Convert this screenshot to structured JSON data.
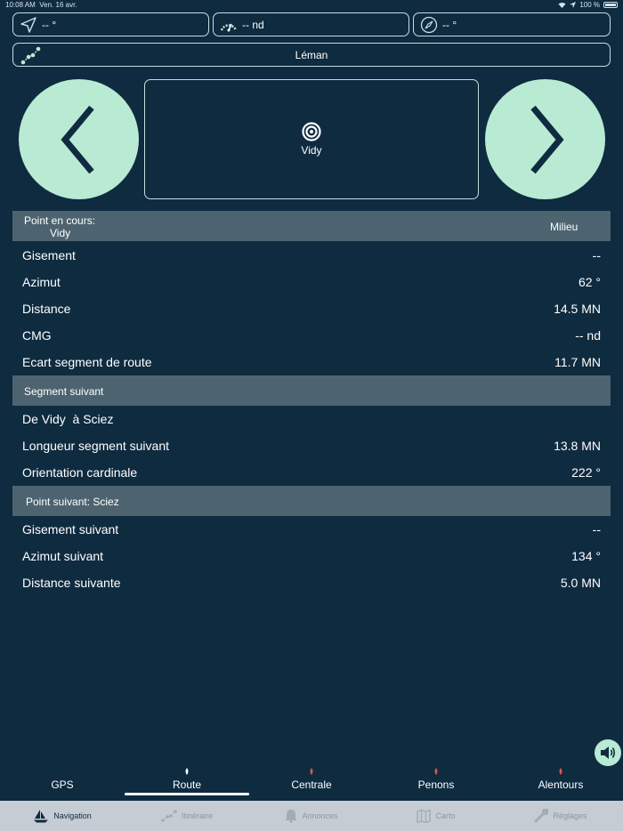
{
  "status_bar": {
    "time": "10:08 AM",
    "date": "Ven. 16 avr.",
    "battery": "100 %"
  },
  "info_boxes": [
    {
      "icon": "location-arrow-icon",
      "value": "-- °"
    },
    {
      "icon": "speedometer-icon",
      "value": "-- nd"
    },
    {
      "icon": "compass-icon",
      "value": "-- °"
    }
  ],
  "lake": {
    "icon": "route-dots-icon",
    "label": "Léman"
  },
  "target": {
    "icon": "target-icon",
    "label": "Vidy"
  },
  "current_point": {
    "header_label": "Point en cours:",
    "header_name": "Vidy",
    "header_right": "Milieu"
  },
  "current_rows": [
    {
      "label": "Gisement",
      "value": "--"
    },
    {
      "label": "Azimut",
      "value": "62 °"
    },
    {
      "label": "Distance",
      "value": "14.5 MN"
    },
    {
      "label": "CMG",
      "value": "-- nd"
    },
    {
      "label": "Ecart segment de route",
      "value": "11.7 MN"
    }
  ],
  "segment": {
    "header": "Segment suivant"
  },
  "segment_rows": [
    {
      "label": "De Vidy  à Sciez",
      "value": ""
    },
    {
      "label": "Longueur segment suivant",
      "value": "13.8 MN"
    },
    {
      "label": "Orientation cardinale",
      "value": "222 °"
    }
  ],
  "next_point": {
    "header": "Point suivant: Sciez"
  },
  "next_rows": [
    {
      "label": "Gisement suivant",
      "value": "--"
    },
    {
      "label": "Azimut suivant",
      "value": "134 °"
    },
    {
      "label": "Distance suivante",
      "value": "5.0 MN"
    }
  ],
  "sub_tabs": [
    {
      "label": "GPS",
      "indicator": "none"
    },
    {
      "label": "Route",
      "indicator": "white"
    },
    {
      "label": "Centrale",
      "indicator": "red"
    },
    {
      "label": "Penons",
      "indicator": "red"
    },
    {
      "label": "Alentours",
      "indicator": "red"
    }
  ],
  "tab_bar": [
    {
      "label": "Navigation",
      "icon": "sailboat-icon",
      "active": true
    },
    {
      "label": "Itinéraire",
      "icon": "route-icon",
      "active": false
    },
    {
      "label": "Annonces",
      "icon": "bell-icon",
      "active": false
    },
    {
      "label": "Carto",
      "icon": "map-icon",
      "active": false
    },
    {
      "label": "Réglages",
      "icon": "wrench-icon",
      "active": false
    }
  ],
  "colors": {
    "background": "#0f2b40",
    "accent": "#b9ead3",
    "header_bar": "#4d6470",
    "tab_bar": "#c5ccd4",
    "indicator_red": "#e0584a"
  }
}
